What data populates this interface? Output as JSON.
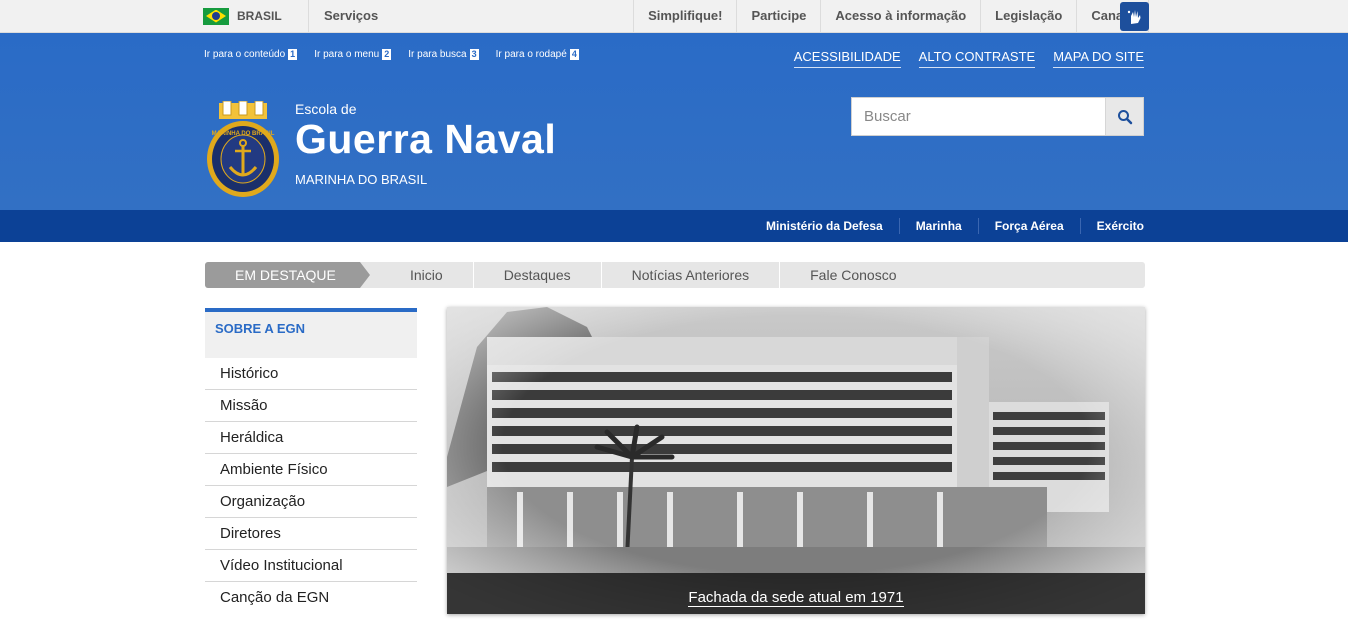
{
  "govbar": {
    "brasil_label": "BRASIL",
    "servicos_label": "Serviços",
    "links": [
      "Simplifique!",
      "Participe",
      "Acesso à informação",
      "Legislação",
      "Canais"
    ],
    "accent": "#1d4f9c"
  },
  "header": {
    "skip_links": [
      {
        "label": "Ir para o conteúdo",
        "key": "1"
      },
      {
        "label": "Ir para o menu",
        "key": "2"
      },
      {
        "label": "Ir para busca",
        "key": "3"
      },
      {
        "label": "Ir para o rodapé",
        "key": "4"
      }
    ],
    "accessibility_links": [
      "ACESSIBILIDADE",
      "ALTO CONTRASTE",
      "MAPA DO SITE"
    ],
    "site_pre_title": "Escola de",
    "site_title": "Guerra Naval",
    "site_subtitle": "MARINHA DO BRASIL",
    "logo_text": "MARINHA DO BRASIL",
    "search_placeholder": "Buscar",
    "colors": {
      "primary": "#2a6bc6",
      "dark": "#0c4196"
    }
  },
  "ministry_bar": {
    "links": [
      "Ministério da Defesa",
      "Marinha",
      "Força Aérea",
      "Exército"
    ]
  },
  "section_nav": {
    "title": "EM DESTAQUE",
    "tabs": [
      "Inicio",
      "Destaques",
      "Notícias Anteriores",
      "Fale Conosco"
    ]
  },
  "sidebar": {
    "heading": "SOBRE A EGN",
    "items": [
      "Histórico",
      "Missão",
      "Heráldica",
      "Ambiente Físico",
      "Organização",
      "Diretores",
      "Vídeo Institucional",
      "Canção da EGN"
    ]
  },
  "carousel": {
    "caption": "Fachada da sede atual em 1971"
  }
}
